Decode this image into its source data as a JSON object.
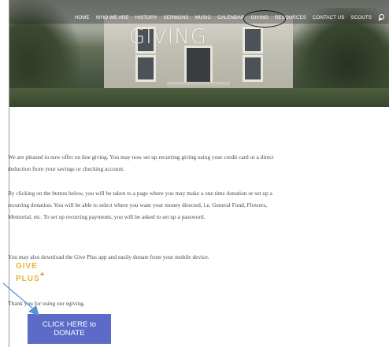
{
  "nav": {
    "items": [
      "HOME",
      "WHO WE ARE",
      "HISTORY",
      "SERMONS",
      "MUSIC",
      "CALENDAR",
      "GIVING",
      "RESOURCES",
      "CONTACT US",
      "SCOUTS"
    ],
    "active": "GIVING"
  },
  "hero": {
    "title": "GIVING"
  },
  "content": {
    "p1": "We are pleased to now offer on line giving.  You may now set up recurring giving using your credit card or a direct deduction from your savings or checking account.",
    "p2": "By clicking on the button below, you will be taken to a page where you may make a one time donation or set up a recurring donation.  You will be able to select where you want your money directed, i.e. General Fund, Flowers, Memorial, etc.  To set up recurring payments, you will be asked to set up a password.",
    "p3": "You may also download the Give Plus app and easily donate from your mobile device.",
    "p4": "Thank you for using our egiving."
  },
  "logo": {
    "line1": "GIVE",
    "line2": "PLUS",
    "mark": "+"
  },
  "donate": {
    "label": "CLICK HERE to DONATE"
  },
  "colors": {
    "button": "#5b6bc7",
    "logo": "#e8b43b",
    "arrow": "#5b8fd6"
  }
}
